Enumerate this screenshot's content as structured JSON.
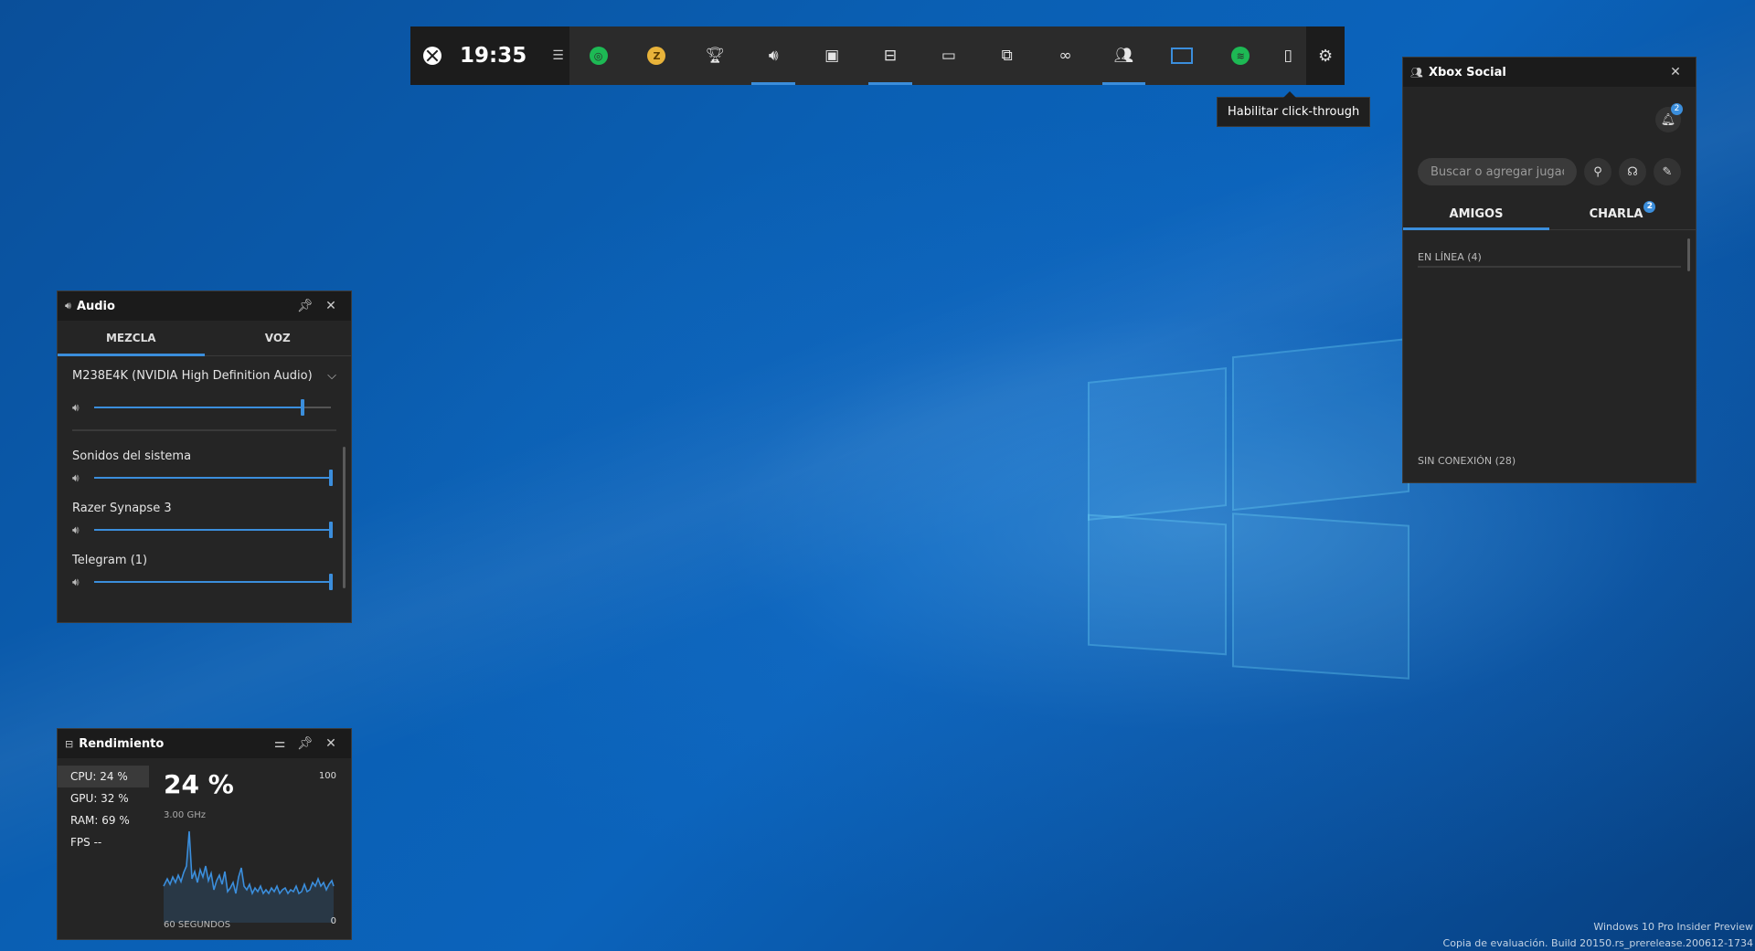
{
  "topbar": {
    "clock": "19:35",
    "tooltip": "Habilitar click-through"
  },
  "audio": {
    "title": "Audio",
    "tabs": [
      "MEZCLA",
      "VOZ"
    ],
    "device": "M238E4K (NVIDIA High Definition Audio)",
    "master_level": 0.88,
    "apps": [
      {
        "name": "Sonidos del sistema",
        "level": 1.0
      },
      {
        "name": "Razer Synapse 3",
        "level": 1.0
      },
      {
        "name": "Telegram (1)",
        "level": 1.0
      }
    ]
  },
  "performance": {
    "title": "Rendimiento",
    "stats": [
      "CPU:  24 %",
      "GPU:  32 %",
      "RAM:  69 %",
      "FPS  --"
    ],
    "big_value": "24 %",
    "frequency": "3.00 GHz",
    "max_label": "100",
    "min_label": "0",
    "time_label": "60 SEGUNDOS"
  },
  "social": {
    "title": "Xbox Social",
    "notification_count": "2",
    "search_placeholder": "Buscar o agregar jugador",
    "tabs": [
      "AMIGOS",
      "CHARLA"
    ],
    "chat_badge": "2",
    "online": "EN LÍNEA  (4)",
    "offline": "SIN CONEXIÓN  (28)"
  },
  "watermark": {
    "line1": "Windows 10 Pro Insider Preview",
    "line2": "Copia de evaluación. Build 20150.rs_prerelease.200612-1734"
  },
  "colors": {
    "accent": "#3b8edc",
    "spotify": "#1db954",
    "achievement": "#e8b33a"
  }
}
